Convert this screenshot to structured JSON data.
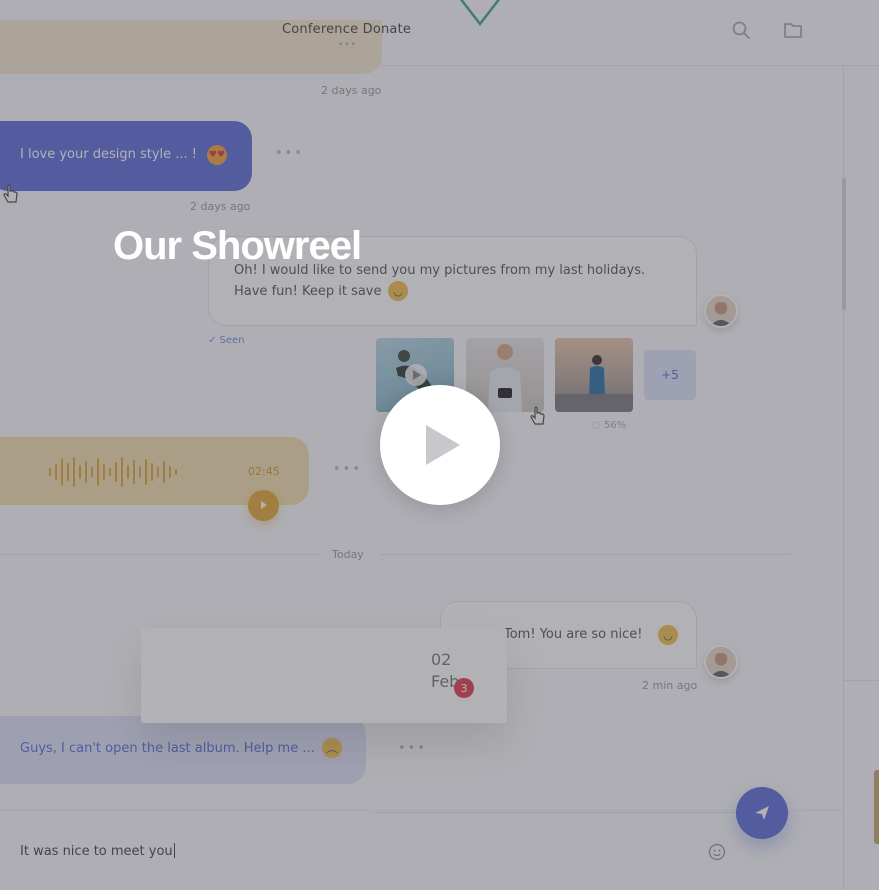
{
  "header": {
    "title": "Conference Donate",
    "dots": "•••",
    "icons": [
      "search-icon",
      "folder-icon"
    ]
  },
  "messages": [
    {
      "id": "m1",
      "timestamp": "2 days ago"
    },
    {
      "id": "m2",
      "text": "I love your design style ... !",
      "emoji": "heart-eyes",
      "timestamp": "2 days ago",
      "more": "•••"
    },
    {
      "id": "m3",
      "line1": "Oh! I would like to send you my pictures from my last holidays.",
      "line2": "Have fun! Keep it save",
      "emoji": "grin",
      "status": "✓ Seen"
    },
    {
      "id": "m4",
      "attachments": {
        "more_label": "+5",
        "progress": "56%"
      }
    },
    {
      "id": "m5",
      "voice_duration": "02:45",
      "more": "•••"
    },
    {
      "id": "m6",
      "text": "Tom! You are so nice!",
      "emoji": "grin",
      "timestamp": "2 min ago"
    },
    {
      "id": "m7",
      "text": "Guys, I can't open the last album. Help me ...",
      "emoji": "sad",
      "more": "•••"
    }
  ],
  "divider": {
    "label": "Today"
  },
  "popup": {
    "day": "02",
    "month": "Feb",
    "badge": "3"
  },
  "composer": {
    "value": "It was nice to meet you"
  },
  "overlay": {
    "title": "Our Showreel"
  },
  "colors": {
    "accent": "#5c6dd6",
    "voice": "#e3a935",
    "badge": "#e63c4e"
  }
}
